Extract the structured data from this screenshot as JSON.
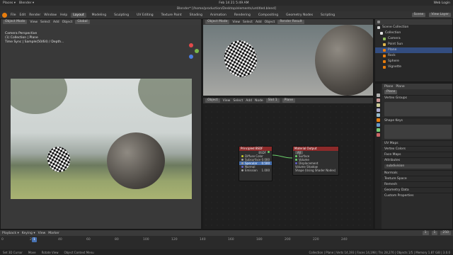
{
  "os": {
    "left": [
      "Places ▾",
      "Blender ▾"
    ],
    "clock": "Feb 14 21 5:49 AM",
    "right": [
      "Web Login"
    ]
  },
  "window_title": "Blender* [/home/production/Desktop/elements/untitled.blend]",
  "menu": {
    "items": [
      "File",
      "Edit",
      "Render",
      "Window",
      "Help"
    ],
    "tabs": [
      "Layout",
      "Modeling",
      "Sculpting",
      "UV Editing",
      "Texture Paint",
      "Shading",
      "Animation",
      "Rendering",
      "Compositing",
      "Geometry Nodes",
      "Scripting"
    ],
    "active_tab": "Layout",
    "scene": "Scene",
    "view_layer": "View Layer"
  },
  "viewport_left": {
    "header": [
      "Object Mode",
      "View",
      "Select",
      "Add",
      "Object"
    ],
    "orientation": "Global",
    "camera_text": [
      "Camera Perspective",
      "(1) Collection | Plane",
      "Time Sync | Sample(50/64) / Depth..."
    ]
  },
  "viewport_right": {
    "header": [
      "Object Mode",
      "View",
      "Select",
      "Add",
      "Object"
    ],
    "shading": "Render Result"
  },
  "node_editor": {
    "header": [
      "Object",
      "View",
      "Select",
      "Add",
      "Node",
      "Use Nodes"
    ],
    "slot": "Slot 1",
    "material": "Plane",
    "principled": {
      "title": "Principled BSDF",
      "out": "BSDF",
      "inputs": [
        {
          "label": "Diffuse Color",
          "value": ""
        },
        {
          "label": "Subsurface",
          "value": "0.000"
        },
        {
          "label": "Specular",
          "value": "0.500"
        },
        {
          "label": "Normal",
          "value": ""
        },
        {
          "label": "Emission",
          "value": "1.000"
        }
      ]
    },
    "output": {
      "title": "Material Output",
      "target": "All",
      "inputs": [
        "Surface",
        "Volume",
        "Displacement"
      ],
      "extra": [
        "Volume Shadow",
        "Shape (Using Shader Nodes)"
      ]
    }
  },
  "outliner": {
    "items": [
      {
        "label": "Scene Collection",
        "color": "#cccccc",
        "selected": false
      },
      {
        "label": "Collection",
        "color": "#e0e0e0",
        "selected": false
      },
      {
        "label": "Camera",
        "color": "#8fbc5a",
        "selected": false
      },
      {
        "label": "Point Sun",
        "color": "#e0b64a",
        "selected": false
      },
      {
        "label": "Plane",
        "color": "#e87d0d",
        "selected": true
      },
      {
        "label": "Rock",
        "color": "#e87d0d",
        "selected": false
      },
      {
        "label": "Sphere",
        "color": "#e87d0d",
        "selected": false
      },
      {
        "label": "Vignette",
        "color": "#e87d0d",
        "selected": false
      }
    ]
  },
  "properties": {
    "object": "Plane",
    "data": "Plane",
    "sections": [
      "Vertex Groups",
      "Shape Keys",
      "UV Maps",
      "Vertex Colors",
      "Face Maps",
      "Attributes",
      "Normals",
      "Texture Space",
      "Remesh",
      "Geometry Data",
      "Custom Properties"
    ],
    "attribute_item": "subdivision"
  },
  "timeline": {
    "header": [
      "Playback ▾",
      "Keying ▾",
      "View",
      "Marker"
    ],
    "current_frame": "1",
    "start": "1",
    "end": "250",
    "ticks": [
      "0",
      "20",
      "40",
      "60",
      "80",
      "100",
      "120",
      "140",
      "160",
      "180",
      "200",
      "220",
      "240"
    ]
  },
  "status": {
    "left": [
      "Set 3D Cursor",
      "Move",
      "Rotate View",
      "Object Context Menu"
    ],
    "right": "Collection | Plane | Verts 14,193 | Faces 14,198 | Tris 28,276 | Objects 1/5 | Memory 1.87 GiB | 3.0.0"
  },
  "colors": {
    "accent": "#4772b3",
    "brand": "#e87d0d",
    "node_header": "#8c2a2a"
  }
}
